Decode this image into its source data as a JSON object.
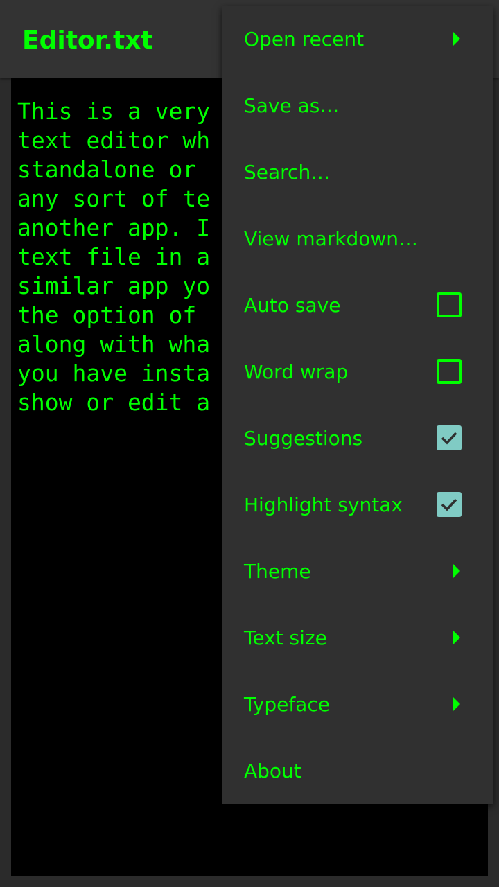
{
  "app_bar": {
    "title": "Editor.txt"
  },
  "editor": {
    "lines": [
      "This is a very",
      "text editor wh",
      "standalone or ",
      "any sort of te",
      "another app. I",
      "text file in a",
      "similar app yo",
      "the option of ",
      "along with wha",
      "you have insta",
      "show or edit a"
    ]
  },
  "menu": {
    "items": [
      {
        "label": "Open recent",
        "control": "submenu"
      },
      {
        "label": "Save as…",
        "control": "none"
      },
      {
        "label": "Search…",
        "control": "none"
      },
      {
        "label": "View markdown…",
        "control": "none"
      },
      {
        "label": "Auto save",
        "control": "checkbox",
        "checked": false
      },
      {
        "label": "Word wrap",
        "control": "checkbox",
        "checked": false
      },
      {
        "label": "Suggestions",
        "control": "checkbox",
        "checked": true
      },
      {
        "label": "Highlight syntax",
        "control": "checkbox",
        "checked": true
      },
      {
        "label": "Theme",
        "control": "submenu"
      },
      {
        "label": "Text size",
        "control": "submenu"
      },
      {
        "label": "Typeface",
        "control": "submenu"
      },
      {
        "label": "About",
        "control": "none"
      }
    ]
  },
  "colors": {
    "accent": "#00ff00",
    "checkbox_checked_fill": "#80cbc4",
    "checkmark": "#303030",
    "menu_background": "#303030",
    "app_bar_background": "#333333",
    "editor_background": "#000000"
  },
  "icons": {
    "submenu": "triangle-right-icon",
    "checkbox_checked": "checkmark-icon"
  }
}
